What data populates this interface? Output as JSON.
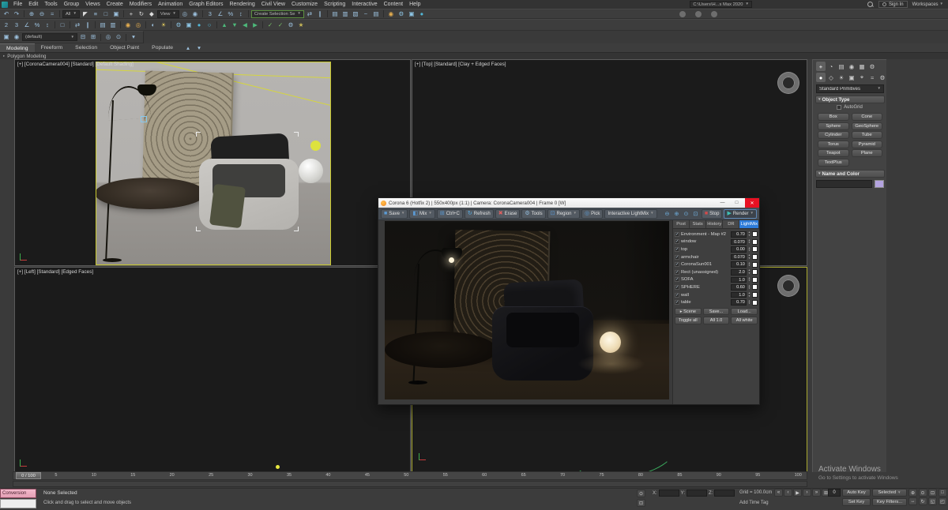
{
  "menubar": {
    "items": [
      "File",
      "Edit",
      "Tools",
      "Group",
      "Views",
      "Create",
      "Modifiers",
      "Animation",
      "Graph Editors",
      "Rendering",
      "Civil View",
      "Customize",
      "Scripting",
      "Interactive",
      "Content",
      "Help"
    ],
    "project_path": "C:\\Users\\H...s Max 2020",
    "sign_in": "Sign In",
    "workspaces": "Workspaces"
  },
  "toolbars": {
    "filter_value": "All",
    "coord_value": "View",
    "selection_set_value": "Create Selection Se",
    "modifier_set_value": "(default)",
    "row1a": [
      {
        "n": "undo",
        "g": "↶"
      },
      {
        "n": "redo",
        "g": "↷"
      },
      {
        "sep": true
      },
      {
        "n": "select-and-link",
        "g": "⊕"
      },
      {
        "n": "unlink-selection",
        "g": "⊖"
      },
      {
        "n": "bind-to-space-warp",
        "g": "≈"
      },
      {
        "sep": true
      }
    ],
    "row1b": [
      {
        "n": "select-object",
        "g": "◤",
        "c": "#dcdcdc"
      },
      {
        "n": "select-by-name",
        "g": "≡"
      },
      {
        "n": "rectangular-selection-region",
        "g": "□"
      },
      {
        "n": "window-crossing-toggle",
        "g": "▣"
      },
      {
        "sep": true
      },
      {
        "n": "select-and-move",
        "g": "+",
        "c": "#dcdcdc"
      },
      {
        "n": "select-and-rotate",
        "g": "↻",
        "c": "#dcdcdc"
      },
      {
        "n": "select-and-scale",
        "g": "◆",
        "c": "#dcdcdc"
      }
    ],
    "row1c": [
      {
        "n": "use-pivot-center",
        "g": "◎"
      },
      {
        "n": "select-and-manipulate",
        "g": "◉"
      },
      {
        "sep": true
      },
      {
        "n": "snap-toggle",
        "g": "3"
      },
      {
        "n": "angle-snap-toggle",
        "g": "∠"
      },
      {
        "n": "percent-snap-toggle",
        "g": "%"
      },
      {
        "n": "spinner-snap-toggle",
        "g": "↕"
      },
      {
        "sep": true
      }
    ],
    "row1d": [
      {
        "n": "mirror",
        "g": "⇄"
      },
      {
        "n": "align",
        "g": "∥"
      },
      {
        "sep": true
      },
      {
        "n": "scene-explorer-toggle",
        "g": "▤"
      },
      {
        "n": "layer-explorer-toggle",
        "g": "▥"
      },
      {
        "n": "ribbon-toggle",
        "g": "▧"
      },
      {
        "n": "curve-editor",
        "g": "~"
      },
      {
        "n": "dope-sheet",
        "g": "▤"
      },
      {
        "sep": true
      },
      {
        "n": "material-editor",
        "g": "◉",
        "c": "#e8b050"
      },
      {
        "n": "render-setup",
        "g": "⚙",
        "c": "#8fc8e8"
      },
      {
        "n": "rendered-frame-window",
        "g": "▣",
        "c": "#8fc8e8"
      },
      {
        "n": "render-production",
        "g": "●",
        "c": "#52b8d8"
      }
    ],
    "row2": [
      {
        "n": "snap-2d",
        "g": "2"
      },
      {
        "n": "snap-3d",
        "g": "3"
      },
      {
        "n": "angle-snap",
        "g": "∠"
      },
      {
        "n": "percent-snap",
        "g": "%"
      },
      {
        "n": "spinner-snap",
        "g": "↕"
      },
      {
        "sep": true
      },
      {
        "n": "edit-named-selection-sets",
        "g": "□"
      },
      {
        "sep": true
      },
      {
        "n": "mirror-tool",
        "g": "⇄"
      },
      {
        "n": "align-tool",
        "g": "∥"
      },
      {
        "sep": true
      },
      {
        "n": "toggle-scene-explorer",
        "g": "▤"
      },
      {
        "n": "toggle-layer-explorer",
        "g": "▥"
      },
      {
        "sep": true
      },
      {
        "n": "material-editor-compact",
        "g": "◉",
        "c": "#e8b050"
      },
      {
        "n": "material-map-navigator",
        "g": "◎",
        "c": "#e8b050"
      },
      {
        "sep": true
      },
      {
        "n": "shade-selected",
        "g": "◐"
      },
      {
        "n": "lighting-analysis",
        "g": "☀",
        "c": "#e8d060"
      },
      {
        "sep": true
      },
      {
        "n": "render-setup-dialog",
        "g": "⚙",
        "c": "#8fc8e8"
      },
      {
        "n": "rendered-frame",
        "g": "▣",
        "c": "#8fc8e8"
      },
      {
        "n": "render",
        "g": "●",
        "c": "#52b8d8"
      },
      {
        "n": "render-iterative",
        "g": "○",
        "c": "#52b8d8"
      },
      {
        "sep": true
      },
      {
        "n": "isolate-up",
        "g": "▲",
        "c": "#4db87a"
      },
      {
        "n": "isolate-down",
        "g": "▼",
        "c": "#4db87a"
      },
      {
        "n": "prev-sibling",
        "g": "◀",
        "c": "#4db87a"
      },
      {
        "n": "next-sibling",
        "g": "▶",
        "c": "#4db87a"
      },
      {
        "sep": true
      },
      {
        "n": "check-a",
        "g": "✓",
        "c": "#7ac46a"
      },
      {
        "n": "check-b",
        "g": "✓",
        "c": "#7ac46a"
      },
      {
        "n": "settings",
        "g": "⚙"
      },
      {
        "n": "favorites",
        "g": "★",
        "c": "#c8b858"
      }
    ],
    "row3a": [
      {
        "n": "show-end-result",
        "g": "▣"
      },
      {
        "n": "pin-stack",
        "g": "◉"
      }
    ],
    "row3b": [
      {
        "n": "absolute-offset-toggle",
        "g": "⊟"
      },
      {
        "n": "offset-mode",
        "g": "⊞"
      },
      {
        "sep": true
      },
      {
        "n": "isolate-selection",
        "g": "◎"
      },
      {
        "n": "selection-lock",
        "g": "⊙"
      },
      {
        "sep": true
      },
      {
        "n": "named-views",
        "g": "▾"
      }
    ]
  },
  "ribbon": {
    "tabs": [
      "Modeling",
      "Freeform",
      "Selection",
      "Object Paint",
      "Populate"
    ],
    "active_tab": "Modeling",
    "icons": [
      {
        "n": "ribbon-minimize",
        "g": "▴"
      },
      {
        "n": "ribbon-options",
        "g": "▾"
      }
    ],
    "strip_label": "Polygon Modeling"
  },
  "viewports": {
    "camera_label": "[+] [CoronaCamera004] [Standard] [Default Shading]",
    "top_label": "[+] [Top] [Standard] [Clay + Edged Faces]",
    "left_label": "[+] [Left] [Standard] [Edged Faces]"
  },
  "corona": {
    "title": "Corona 6 (Hotfix 2) | 550x400px (1:1) | Camera: CoronaCamera004 | Frame 0 [W]",
    "window_buttons": {
      "minimize": "—",
      "maximize": "□",
      "close": "✕"
    },
    "toolbar": [
      {
        "name": "save",
        "label": "Save",
        "caret": true,
        "ico": {
          "g": "■",
          "c": "#5b9bd5"
        }
      },
      {
        "name": "mix",
        "label": "Mix",
        "caret": true,
        "ico": {
          "g": "◧",
          "c": "#5b9bd5"
        }
      },
      {
        "name": "copy",
        "label": "Ctrl+C",
        "ico": {
          "g": "⊞",
          "c": "#5b9bd5"
        }
      },
      {
        "name": "refresh",
        "label": "Refresh",
        "ico": {
          "g": "↻",
          "c": "#58b0e8"
        }
      },
      {
        "name": "erase",
        "label": "Erase",
        "ico": {
          "g": "✖",
          "c": "#e06060"
        }
      },
      {
        "name": "tools",
        "label": "Tools",
        "ico": {
          "g": "⚙",
          "c": "#8fb8d8"
        }
      },
      {
        "name": "region",
        "label": "Region",
        "caret": true,
        "ico": {
          "g": "⊡",
          "c": "#5b9bd5"
        }
      },
      {
        "name": "pick",
        "label": "Pick",
        "ico": {
          "g": "◎",
          "c": "#5b9bd5"
        }
      },
      {
        "name": "interactive-lightmix",
        "label": "Interactive LightMix",
        "caret": true
      }
    ],
    "zoom_icons": [
      {
        "n": "zoom-out",
        "g": "⊖"
      },
      {
        "n": "zoom-in",
        "g": "⊕"
      },
      {
        "n": "zoom-actual",
        "g": "⊙"
      },
      {
        "n": "zoom-fit",
        "g": "⊡"
      }
    ],
    "stop_label": "Stop",
    "render_label": "Render",
    "tabs": [
      "Post",
      "Stats",
      "History",
      "DR",
      "LightMix"
    ],
    "active_tab": "LightMix",
    "lightmix_rows": [
      {
        "label": "Environment - Map #2",
        "value": "0.70"
      },
      {
        "label": "window",
        "value": "0.070"
      },
      {
        "label": "top",
        "value": "0.00"
      },
      {
        "label": "armchair",
        "value": "0.070"
      },
      {
        "label": "CoronaSun001",
        "value": "0.10"
      },
      {
        "label": "Rect (unassigned)",
        "value": "2.0"
      },
      {
        "label": "SOFA",
        "value": "1.0"
      },
      {
        "label": "SPHERE",
        "value": "0.60"
      },
      {
        "label": "wall",
        "value": "1.0"
      },
      {
        "label": "table",
        "value": "0.70"
      }
    ],
    "action_buttons_row1": [
      "▸ Scene",
      "Save...",
      "Load..."
    ],
    "action_buttons_row2": [
      "Toggle all",
      "All 1.0",
      "All white"
    ]
  },
  "command_panel": {
    "tabs": [
      {
        "n": "create-tab",
        "g": "+",
        "active": true
      },
      {
        "n": "modify-tab",
        "g": "◔"
      },
      {
        "n": "hierarchy-tab",
        "g": "▤"
      },
      {
        "n": "motion-tab",
        "g": "◉"
      },
      {
        "n": "display-tab",
        "g": "▦"
      },
      {
        "n": "utilities-tab",
        "g": "⚙"
      }
    ],
    "categories": [
      {
        "n": "geometry-category",
        "g": "●",
        "active": true
      },
      {
        "n": "shapes-category",
        "g": "◇"
      },
      {
        "n": "lights-category",
        "g": "☀"
      },
      {
        "n": "cameras-category",
        "g": "▣"
      },
      {
        "n": "helpers-category",
        "g": "⌖"
      },
      {
        "n": "space-warps-category",
        "g": "≈"
      },
      {
        "n": "systems-category",
        "g": "⚙"
      }
    ],
    "category_dropdown": "Standard Primitives",
    "rollout_object_type": "Object Type",
    "autogrid_label": "AutoGrid",
    "primitive_buttons": [
      "Box",
      "Cone",
      "Sphere",
      "GeoSphere",
      "Cylinder",
      "Tube",
      "Torus",
      "Pyramid",
      "Teapot",
      "Plane",
      "TextPlus"
    ],
    "rollout_name_color": "Name and Color"
  },
  "timeline": {
    "slider_label": "0 / 100",
    "ticks": [
      "0",
      "5",
      "10",
      "15",
      "20",
      "25",
      "30",
      "35",
      "40",
      "45",
      "50",
      "55",
      "60",
      "65",
      "70",
      "75",
      "80",
      "85",
      "90",
      "95",
      "100"
    ]
  },
  "status": {
    "listener_text": "Conversion",
    "selection_status": "None Selected",
    "prompt": "Click and drag to select and move objects",
    "coord_labels": [
      "X:",
      "Y:",
      "Z:"
    ],
    "grid_label": "Grid = 100.0cm",
    "add_time_tag": "Add Time Tag",
    "status_icons": [
      {
        "n": "selection-lock-toggle",
        "g": "⊙"
      },
      {
        "n": "absolute-mode-toggle",
        "g": "⊡"
      }
    ],
    "transport": [
      {
        "n": "go-to-start",
        "g": "«"
      },
      {
        "n": "previous-frame",
        "g": "‹"
      },
      {
        "n": "play-animation",
        "g": "▶"
      },
      {
        "n": "next-frame",
        "g": "›"
      },
      {
        "n": "go-to-end",
        "g": "»"
      },
      {
        "n": "time-configuration",
        "g": "⊞"
      }
    ],
    "frame_value": "0",
    "auto_key": "Auto Key",
    "selected": "Selected",
    "set_key": "Set Key",
    "key_filters": "Key Filters...",
    "nav_icons": [
      {
        "n": "zoom",
        "g": "⊕"
      },
      {
        "n": "zoom-all",
        "g": "⊙"
      },
      {
        "n": "zoom-extents",
        "g": "⊡"
      },
      {
        "n": "zoom-region",
        "g": "□"
      },
      {
        "n": "pan",
        "g": "↔"
      },
      {
        "n": "orbit",
        "g": "↻"
      },
      {
        "n": "field-of-view",
        "g": "◱"
      },
      {
        "n": "maximize-viewport-toggle",
        "g": "◰"
      }
    ]
  },
  "watermark": {
    "line1": "Activate Windows",
    "line2": "Go to Settings to activate Windows"
  }
}
